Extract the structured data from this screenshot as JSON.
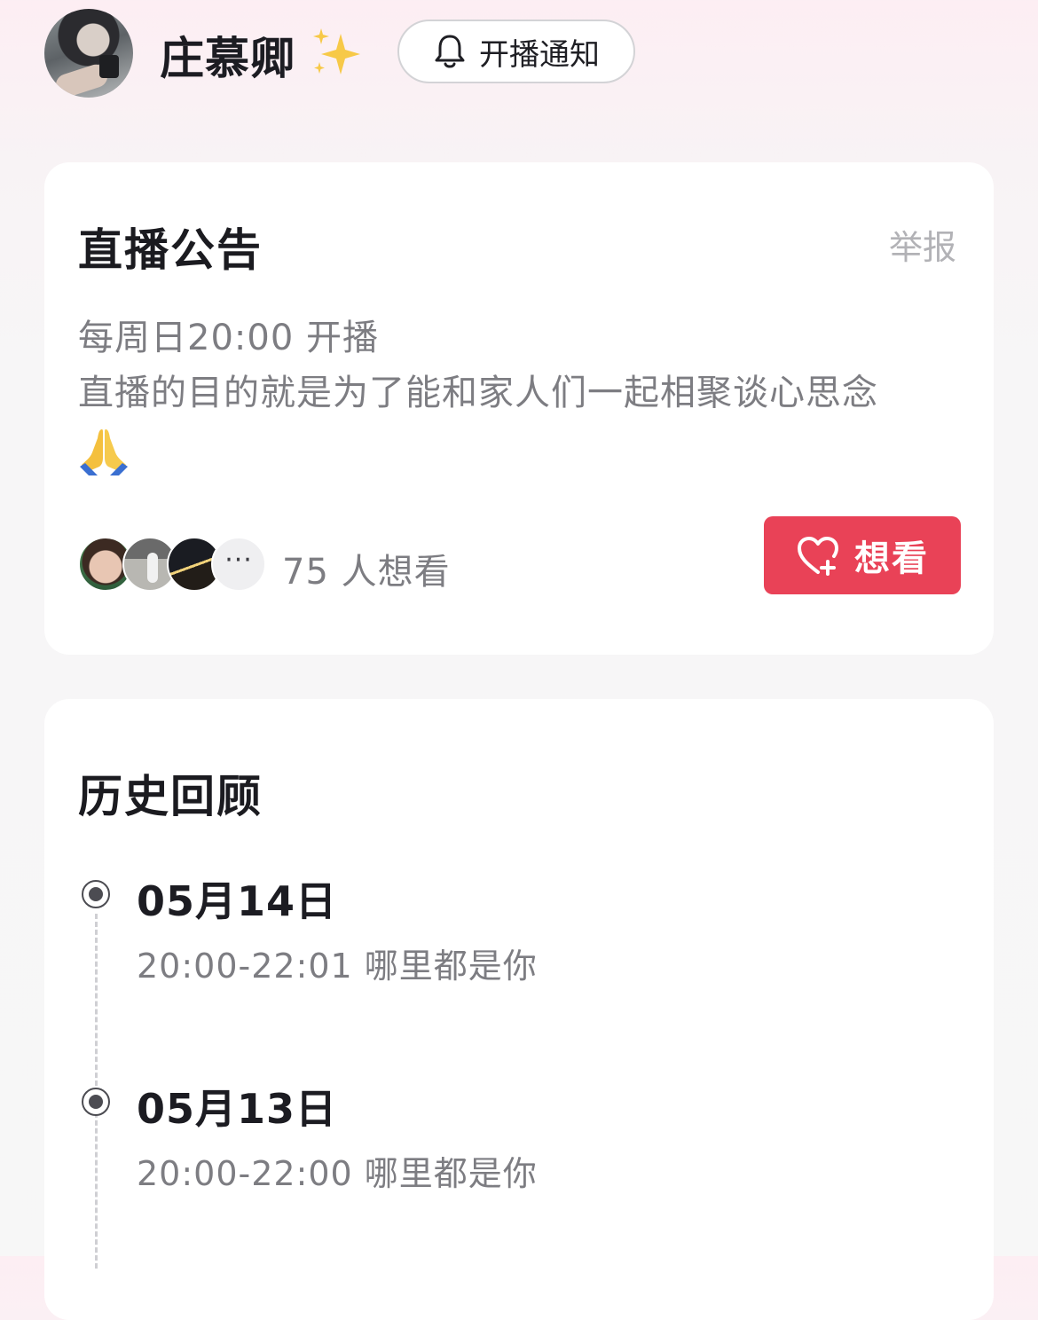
{
  "header": {
    "name": "庄慕卿",
    "notify_label": "开播通知"
  },
  "notice": {
    "title": "直播公告",
    "report_label": "举报",
    "lines": [
      "每周日20:00 开播",
      "直播的目的就是为了能和家人们一起相聚谈心思念"
    ],
    "more_label": "···",
    "viewers_text": "75 人想看",
    "want_label": "想看"
  },
  "history": {
    "title": "历史回顾",
    "entries": [
      {
        "date": "05月14日",
        "desc": "20:00-22:01 哪里都是你"
      },
      {
        "date": "05月13日",
        "desc": "20:00-22:00 哪里都是你"
      }
    ]
  },
  "colors": {
    "accent": "#e94257",
    "muted_text": "#7d7d82"
  }
}
